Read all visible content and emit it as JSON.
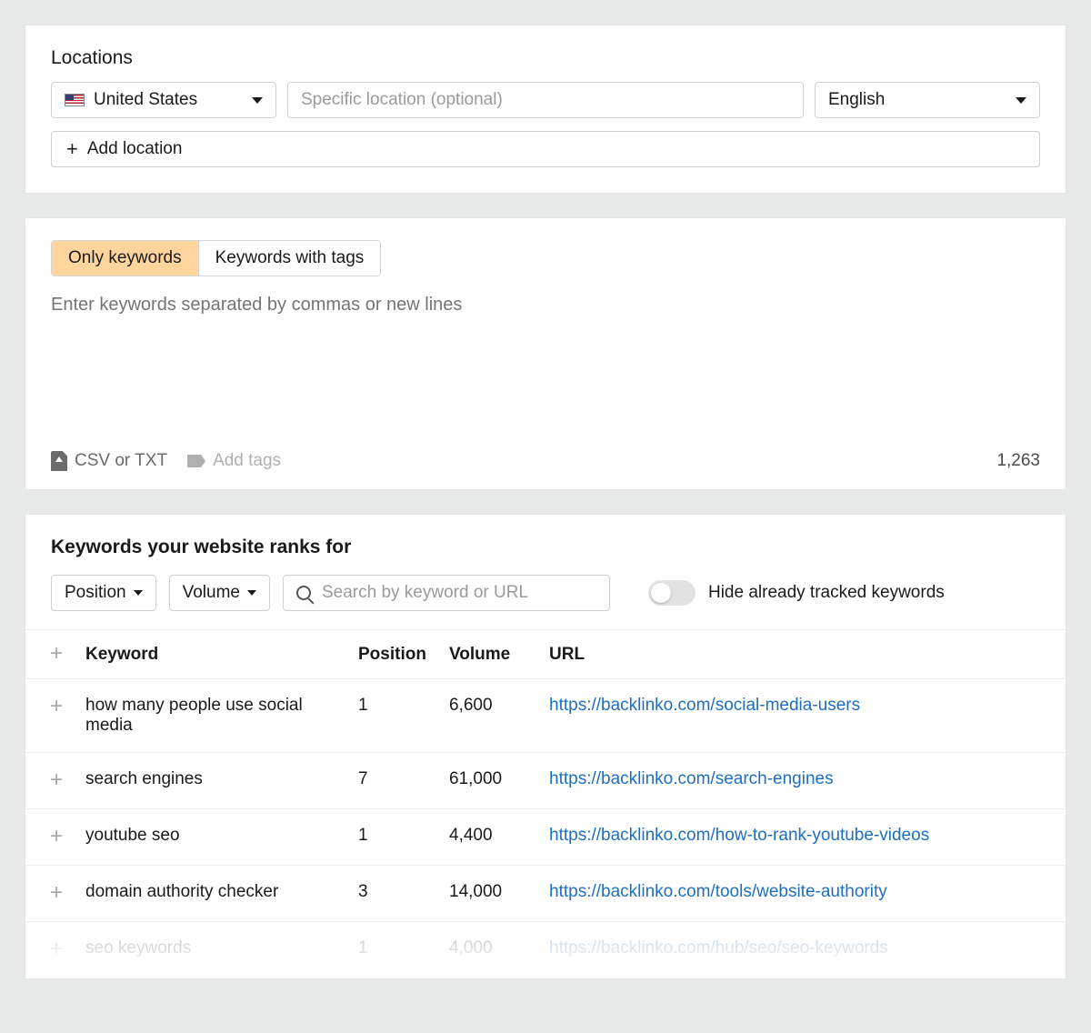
{
  "locations": {
    "heading": "Locations",
    "country_selected": "United States",
    "specific_placeholder": "Specific location (optional)",
    "language_selected": "English",
    "add_location_label": "Add location"
  },
  "keywords_entry": {
    "tabs": {
      "only": "Only keywords",
      "with_tags": "Keywords with tags"
    },
    "textarea_placeholder": "Enter keywords separated by commas or new lines",
    "upload_label": "CSV or TXT",
    "add_tags_label": "Add tags",
    "count": "1,263"
  },
  "rankings": {
    "title": "Keywords your website ranks for",
    "filters": {
      "position": "Position",
      "volume": "Volume"
    },
    "search_placeholder": "Search by keyword or URL",
    "toggle_label": "Hide already tracked keywords",
    "columns": {
      "keyword": "Keyword",
      "position": "Position",
      "volume": "Volume",
      "url": "URL"
    },
    "rows": [
      {
        "keyword": "how many people use social media",
        "position": "1",
        "volume": "6,600",
        "url": "https://backlinko.com/social-media-users",
        "faded": false
      },
      {
        "keyword": "search engines",
        "position": "7",
        "volume": "61,000",
        "url": "https://backlinko.com/search-engines",
        "faded": false
      },
      {
        "keyword": "youtube seo",
        "position": "1",
        "volume": "4,400",
        "url": "https://backlinko.com/how-to-rank-youtube-videos",
        "faded": false
      },
      {
        "keyword": "domain authority checker",
        "position": "3",
        "volume": "14,000",
        "url": "https://backlinko.com/tools/website-authority",
        "faded": false
      },
      {
        "keyword": "seo keywords",
        "position": "1",
        "volume": "4,000",
        "url": "https://backlinko.com/hub/seo/seo-keywords",
        "faded": true
      }
    ]
  }
}
